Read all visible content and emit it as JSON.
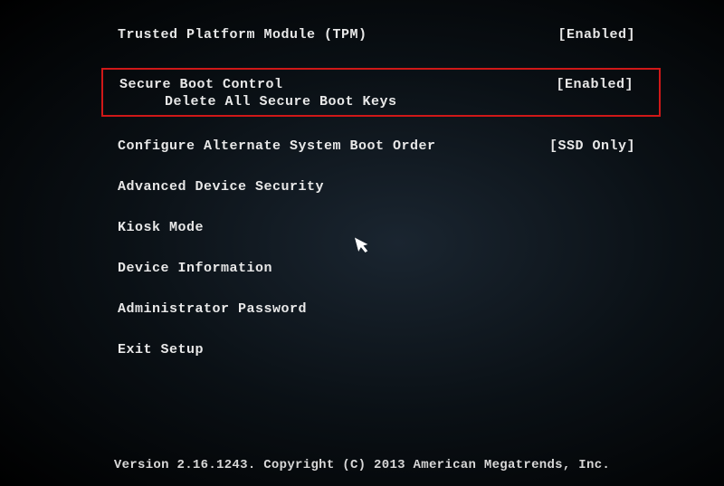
{
  "menu": {
    "tpm": {
      "label": "Trusted Platform Module (TPM)",
      "value": "[Enabled]"
    },
    "secureBoot": {
      "label": "Secure Boot Control",
      "subLabel": "Delete All Secure Boot Keys",
      "value": "[Enabled]"
    },
    "bootOrder": {
      "label": "Configure Alternate System Boot Order",
      "value": "[SSD Only]"
    },
    "advancedSecurity": {
      "label": "Advanced Device Security"
    },
    "kioskMode": {
      "label": "Kiosk Mode"
    },
    "deviceInfo": {
      "label": "Device Information"
    },
    "adminPassword": {
      "label": "Administrator Password"
    },
    "exitSetup": {
      "label": "Exit Setup"
    }
  },
  "footer": {
    "text": "Version 2.16.1243. Copyright (C) 2013 American Megatrends, Inc."
  }
}
